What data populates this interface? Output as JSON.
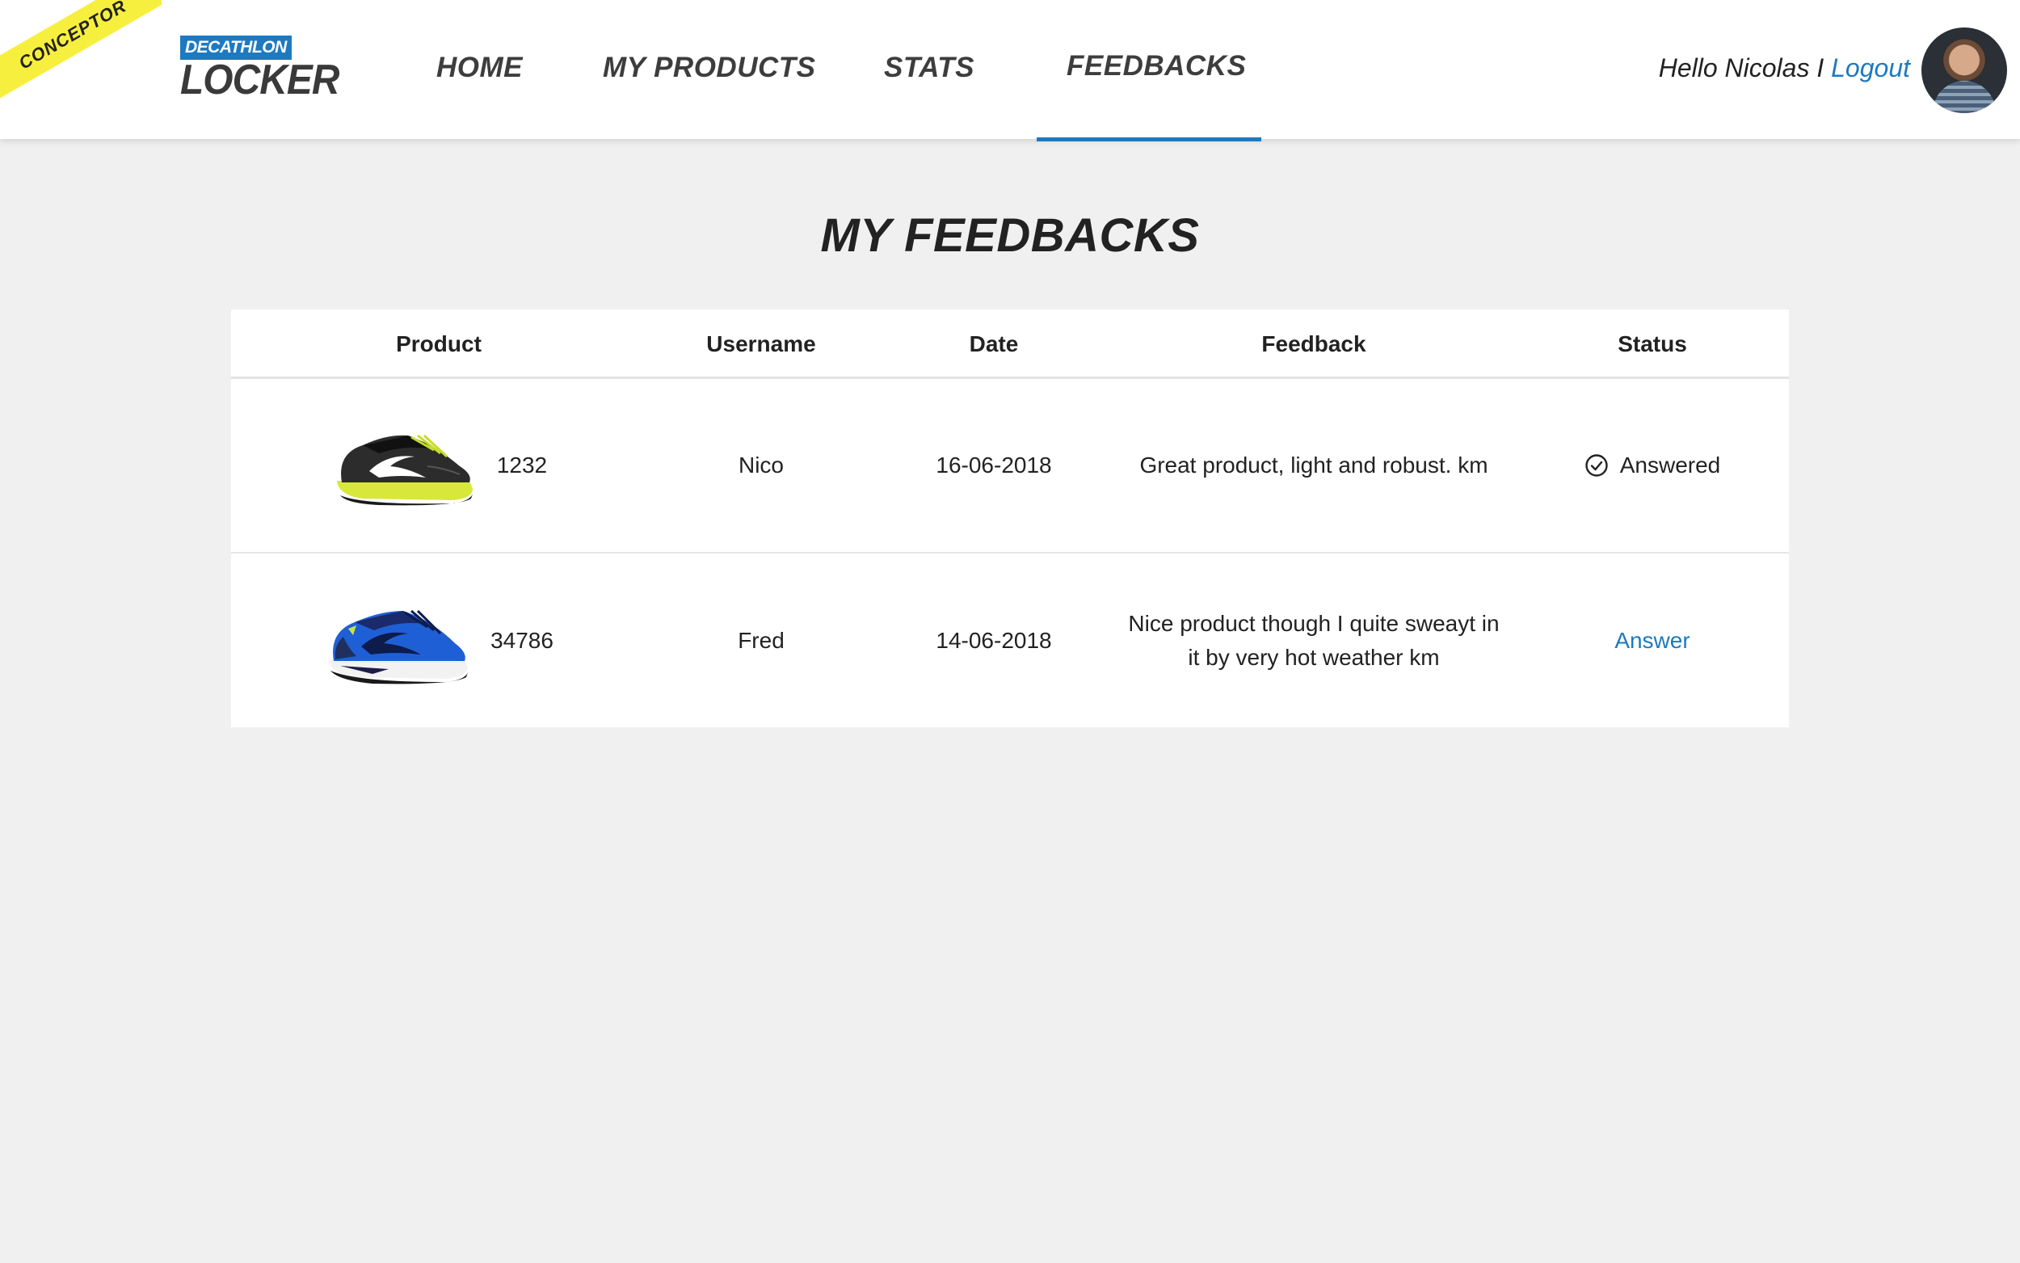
{
  "ribbon": {
    "label": "CONCEPTOR"
  },
  "logo": {
    "badge": "DECATHLON",
    "word": "LOCKER"
  },
  "nav": {
    "items": [
      {
        "label": "HOME"
      },
      {
        "label": "MY PRODUCTS"
      },
      {
        "label": "STATS"
      },
      {
        "label": "FEEDBACKS",
        "active": true
      }
    ]
  },
  "user": {
    "greeting": "Hello Nicolas",
    "separator": " I ",
    "logout": "Logout"
  },
  "page": {
    "title": "MY FEEDBACKS"
  },
  "table": {
    "headers": [
      "Product",
      "Username",
      "Date",
      "Feedback",
      "Status"
    ],
    "rows": [
      {
        "product_id": "1232",
        "product_icon": "trail-shoe-black-yellow",
        "username": "Nico",
        "date": "16-06-2018",
        "feedback": "Great product, light and robust. km",
        "status": "Answered",
        "status_icon": "check-circle-icon"
      },
      {
        "product_id": "34786",
        "product_icon": "running-shoe-blue",
        "username": "Fred",
        "date": "14-06-2018",
        "feedback": "Nice product though I quite sweayt in it by very hot weather km",
        "status": "Answer"
      }
    ]
  },
  "colors": {
    "accent": "#1d7ac0",
    "background": "#f0f0f0",
    "ribbon": "#f7ef3d",
    "text": "#222222"
  }
}
